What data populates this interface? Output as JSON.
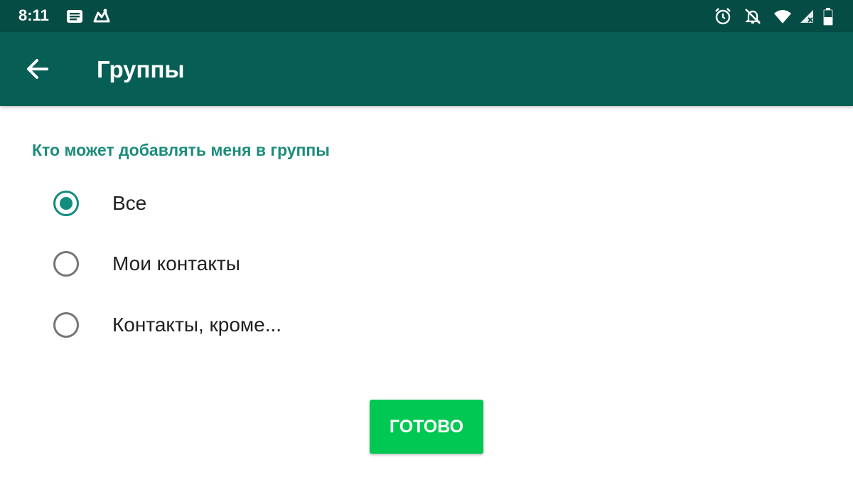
{
  "status_bar": {
    "time": "8:11",
    "left_icons": [
      "message-icon",
      "app-notification-icon"
    ],
    "right_icons": [
      "alarm-icon",
      "notifications-off-icon",
      "wifi-icon",
      "signal-icon",
      "battery-icon"
    ]
  },
  "app_bar": {
    "back_icon": "arrow-left-icon",
    "title": "Группы"
  },
  "section": {
    "heading": "Кто может добавлять меня в группы",
    "options": [
      {
        "label": "Все",
        "selected": true
      },
      {
        "label": "Мои контакты",
        "selected": false
      },
      {
        "label": "Контакты, кроме...",
        "selected": false
      }
    ]
  },
  "done_button": {
    "label": "ГОТОВО"
  },
  "colors": {
    "status_bar": "#054c44",
    "app_bar": "#075e54",
    "accent": "#128c7e",
    "button": "#00c853"
  }
}
